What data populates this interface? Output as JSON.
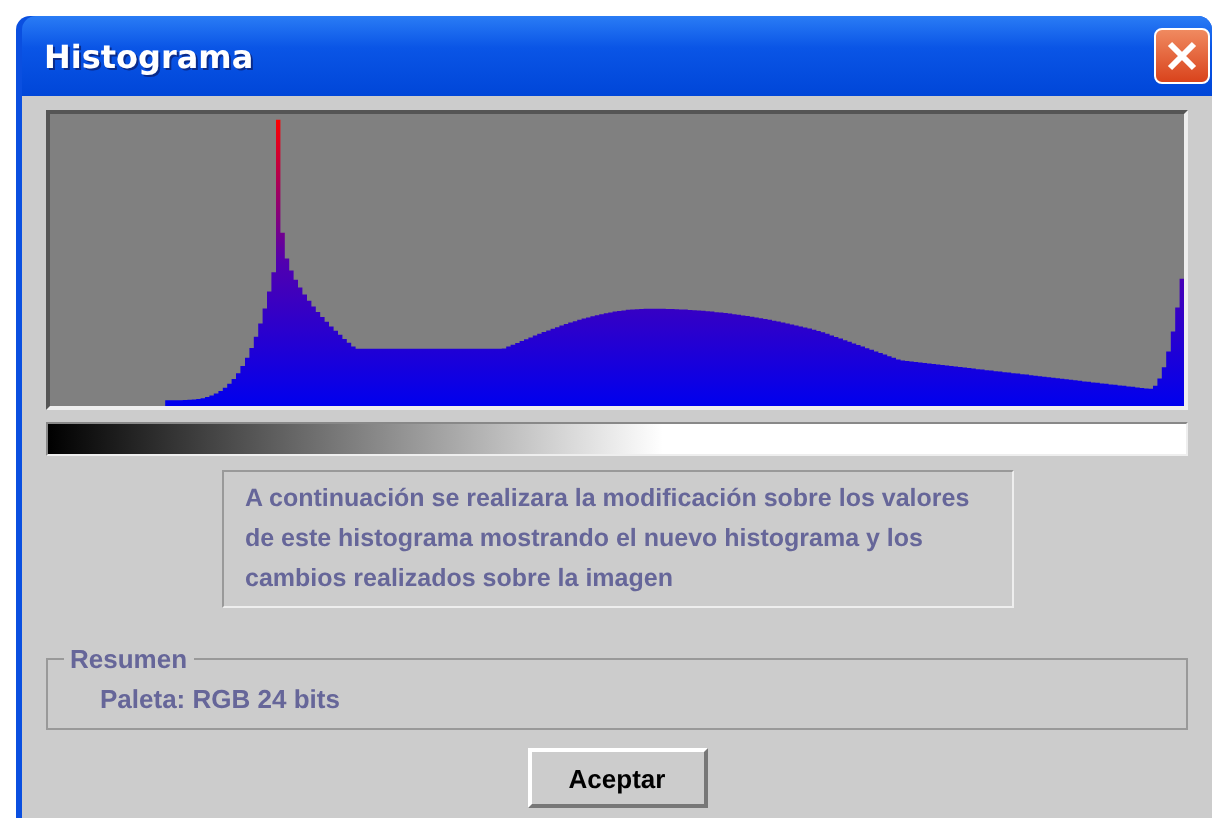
{
  "window": {
    "title": "Histograma"
  },
  "message": "A continuación se realizara la modificación sobre los valores de este histograma mostrando el nuevo histograma y los cambios realizados sobre la imagen",
  "summary": {
    "title": "Resumen",
    "palette": "Paleta: RGB 24 bits"
  },
  "buttons": [
    "Aceptar"
  ]
}
